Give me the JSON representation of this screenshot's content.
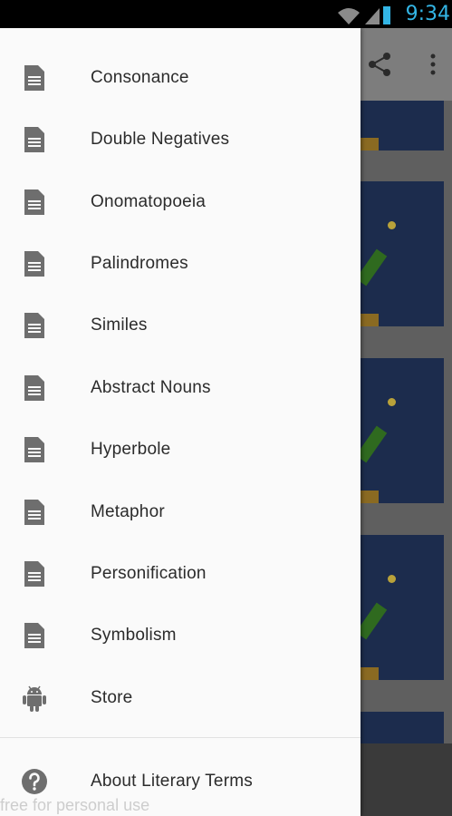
{
  "status_bar": {
    "time": "9:34",
    "icons": [
      "wifi-icon",
      "signal-icon",
      "battery-charging-icon"
    ],
    "time_color": "#33b5e5"
  },
  "action_bar": {
    "icons": [
      "share-icon",
      "overflow-menu-icon"
    ]
  },
  "drawer": {
    "items": [
      {
        "label": "Consonance",
        "icon": "document-icon"
      },
      {
        "label": "Double Negatives",
        "icon": "document-icon"
      },
      {
        "label": "Onomatopoeia",
        "icon": "document-icon"
      },
      {
        "label": "Palindromes",
        "icon": "document-icon"
      },
      {
        "label": "Similes",
        "icon": "document-icon"
      },
      {
        "label": "Abstract Nouns",
        "icon": "document-icon"
      },
      {
        "label": "Hyperbole",
        "icon": "document-icon"
      },
      {
        "label": "Metaphor",
        "icon": "document-icon"
      },
      {
        "label": "Personification",
        "icon": "document-icon"
      },
      {
        "label": "Symbolism",
        "icon": "document-icon"
      },
      {
        "label": "Store",
        "icon": "android-icon"
      }
    ],
    "footer_item": {
      "label": "About Literary Terms",
      "icon": "help-icon"
    }
  },
  "watermark": "free for personal use"
}
